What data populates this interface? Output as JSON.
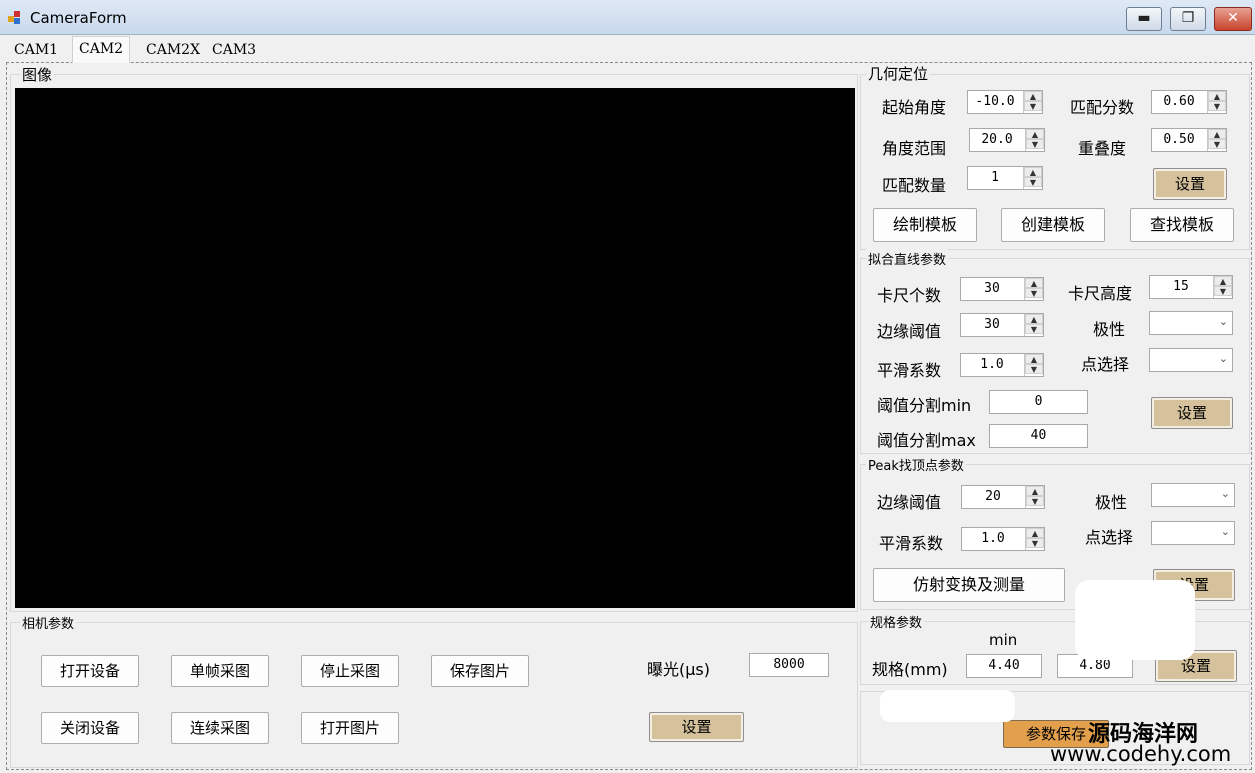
{
  "window": {
    "title": "CameraForm",
    "minimize": "▬",
    "maximize": "❐",
    "close": "✕"
  },
  "tabs": [
    "CAM1",
    "CAM2",
    "CAM2X",
    "CAM3"
  ],
  "image_group": {
    "label": "图像"
  },
  "geo": {
    "label": "几何定位",
    "start_angle_label": "起始角度",
    "start_angle": "-10.0",
    "match_score_label": "匹配分数",
    "match_score": "0.60",
    "angle_range_label": "角度范围",
    "angle_range": "20.0",
    "overlap_label": "重叠度",
    "overlap": "0.50",
    "match_count_label": "匹配数量",
    "match_count": "1",
    "set_label": "设置",
    "draw_template": "绘制模板",
    "create_template": "创建模板",
    "find_template": "查找模板"
  },
  "line": {
    "label": "拟合直线参数",
    "caliper_count_label": "卡尺个数",
    "caliper_count": "30",
    "caliper_height_label": "卡尺高度",
    "caliper_height": "15",
    "edge_thresh_label": "边缘阈值",
    "edge_thresh": "30",
    "polarity_label": "极性",
    "smooth_label": "平滑系数",
    "smooth": "1.0",
    "point_select_label": "点选择",
    "thresh_min_label": "阈值分割min",
    "thresh_min": "0",
    "thresh_max_label": "阈值分割max",
    "thresh_max": "40",
    "set_label": "设置"
  },
  "peak": {
    "label": "Peak找顶点参数",
    "edge_thresh_label": "边缘阈值",
    "edge_thresh": "20",
    "polarity_label": "极性",
    "smooth_label": "平滑系数",
    "smooth": "1.0",
    "point_select_label": "点选择",
    "affine_button": "仿射变换及测量",
    "set_label": "设置"
  },
  "spec": {
    "label": "规格参数",
    "min_label": "min",
    "row_label": "规格(mm)",
    "min_value": "4.40",
    "max_value": "4.80",
    "set_label": "设置",
    "save_button": "参数保存"
  },
  "camera": {
    "label": "相机参数",
    "open_device": "打开设备",
    "single_grab": "单帧采图",
    "stop_grab": "停止采图",
    "save_image": "保存图片",
    "close_device": "关闭设备",
    "continuous_grab": "连续采图",
    "open_image": "打开图片",
    "exposure_label": "曝光(μs)",
    "exposure": "8000",
    "set_label": "设置"
  },
  "watermark": {
    "line1": "源码海洋网",
    "line2": "www.codehy.com"
  },
  "colors": {
    "accent_tan": "#d5c19c",
    "accent_orange": "#e2a04c",
    "image_bg": "#000000"
  }
}
